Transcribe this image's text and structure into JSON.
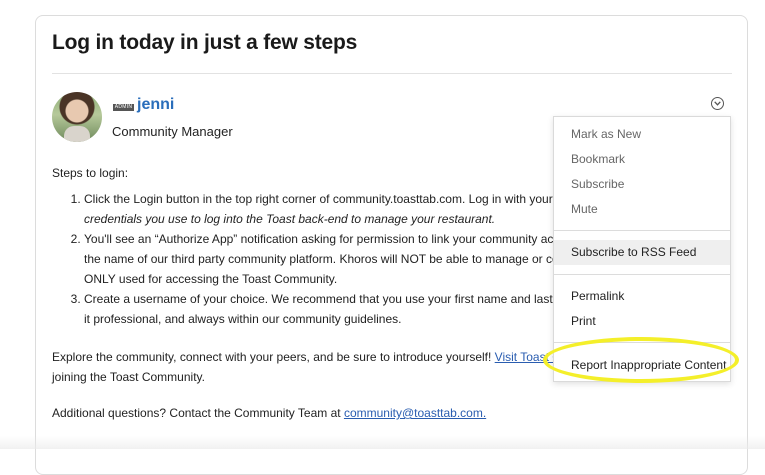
{
  "post": {
    "title": "Log in today in just a few steps",
    "author": {
      "badge": "ADMIN",
      "name": "jenni",
      "role": "Community Manager"
    },
    "steps_intro": "Steps to login:",
    "steps": [
      {
        "line1": "Click the Login button in the top right corner of community.toasttab.com. Log in with your Toast W",
        "line2": "credentials you use to log into the Toast back-end to manage your restaurant."
      },
      {
        "line1": "You'll see an “Authorize App” notification asking for permission to link your community account to",
        "line2": "the name of our third party community platform. Khoros will NOT be able to manage or control ar",
        "line3": "ONLY used for accessing the Toast Community."
      },
      {
        "line1": "Create a username of your choice. We recommend that you use your first name and last initial or y",
        "line2": "it professional, and always within our community guidelines."
      }
    ],
    "explore_before": "Explore the community, connect with your peers, and be sure to introduce yourself! ",
    "explore_link": "Visit Toast Central",
    "explore_after": " fo",
    "explore_line2": "joining the Toast Community.",
    "contact_prefix": "Additional questions? Contact the Community Team at ",
    "contact_email": "community@toasttab.com."
  },
  "menu": {
    "items": [
      "Mark as New",
      "Bookmark",
      "Subscribe",
      "Mute",
      "Subscribe to RSS Feed",
      "Permalink",
      "Print",
      "Report Inappropriate Content"
    ]
  },
  "colors": {
    "link": "#2a5db0",
    "username": "#2a6ebb",
    "annotation_highlight": "#f4ef2a",
    "menu_hover": "#efefef"
  },
  "icons": {
    "options": "chevron-down-icon"
  }
}
